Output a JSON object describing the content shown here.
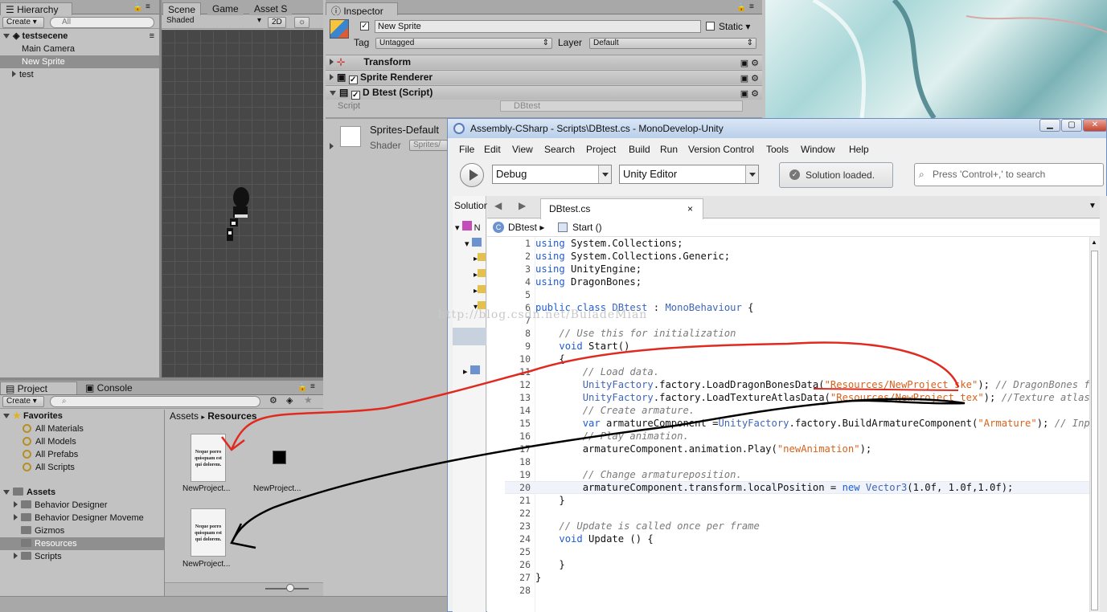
{
  "hierarchy": {
    "tab": "Hierarchy",
    "create": "Create",
    "search_placeholder": "All",
    "scene": "testsecene",
    "items": [
      "Main Camera",
      "New Sprite",
      "test"
    ]
  },
  "scene": {
    "tabs": [
      "Scene",
      "Game",
      "Asset S"
    ],
    "shading": "Shaded",
    "mode2d": "2D"
  },
  "inspector": {
    "tab": "Inspector",
    "name": "New Sprite",
    "static_label": "Static",
    "tag_label": "Tag",
    "tag_value": "Untagged",
    "layer_label": "Layer",
    "layer_value": "Default",
    "components": [
      "Transform",
      "Sprite Renderer",
      "D Btest (Script)"
    ],
    "script_label": "Script",
    "script_value": "DBtest",
    "material_name": "Sprites-Default",
    "shader_label": "Shader",
    "shader_value": "Sprites/"
  },
  "project": {
    "tabs": [
      "Project",
      "Console"
    ],
    "create": "Create",
    "favorites_label": "Favorites",
    "favorites": [
      "All Materials",
      "All Models",
      "All Prefabs",
      "All Scripts"
    ],
    "assets_label": "Assets",
    "assets": [
      "Behavior Designer",
      "Behavior Designer Moveme",
      "Gizmos",
      "Resources",
      "Scripts"
    ],
    "breadcrumb": [
      "Assets",
      "Resources"
    ],
    "files": [
      "NewProject...",
      "NewProject...",
      "NewProject..."
    ],
    "doc_text": "Neque porro quisquam est qui dolorem."
  },
  "monodevelop": {
    "title": "Assembly-CSharp - Scripts\\DBtest.cs - MonoDevelop-Unity",
    "menu": [
      "File",
      "Edit",
      "View",
      "Search",
      "Project",
      "Build",
      "Run",
      "Version Control",
      "Tools",
      "Window",
      "Help"
    ],
    "config": "Debug",
    "target": "Unity Editor",
    "status": "Solution loaded.",
    "search_placeholder": "Press 'Control+,' to search",
    "solution_tab": "Solution",
    "file_tab": "DBtest.cs",
    "breadcrumb_class": "DBtest",
    "breadcrumb_method": "Start ()",
    "watermark": "http://blog.csdn.net/BuladeMian",
    "line_numbers": [
      "1",
      "2",
      "3",
      "4",
      "5",
      "6",
      "7",
      "8",
      "9",
      "10",
      "11",
      "12",
      "13",
      "14",
      "15",
      "16",
      "17",
      "18",
      "19",
      "20",
      "21",
      "22",
      "23",
      "24",
      "25",
      "26",
      "27",
      "28"
    ],
    "code_lines": [
      "using System.Collections;",
      "using System.Collections.Generic;",
      "using UnityEngine;",
      "using DragonBones;",
      "",
      "public class DBtest : MonoBehaviour {",
      "",
      "    // Use this for initialization",
      "    void Start()",
      "    {",
      "        // Load data.",
      "        UnityFactory.factory.LoadDragonBonesData(\"Resources/NewProject_ske\"); // DragonBones file ",
      "        UnityFactory.factory.LoadTextureAtlasData(\"Resources/NewProject_tex\"); //Texture atlas fil",
      "        // Create armature.",
      "        var armatureComponent =UnityFactory.factory.BuildArmatureComponent(\"Armature\"); // Input a",
      "        // Play animation.",
      "        armatureComponent.animation.Play(\"newAnimation\");",
      "",
      "        // Change armatureposition.",
      "        armatureComponent.transform.localPosition = new Vector3(1.0f, 1.0f,1.0f);",
      "    }",
      "",
      "    // Update is called once per frame",
      "    void Update () {",
      "",
      "    }",
      "}",
      ""
    ]
  },
  "colors": {
    "unity_bg": "#c2c2c2",
    "scene_bg": "#474747",
    "keyword": "#1e5bd6",
    "string": "#d6621b",
    "comment": "#7a7a7a",
    "annotation_red": "#e02a20",
    "annotation_black": "#000000"
  }
}
